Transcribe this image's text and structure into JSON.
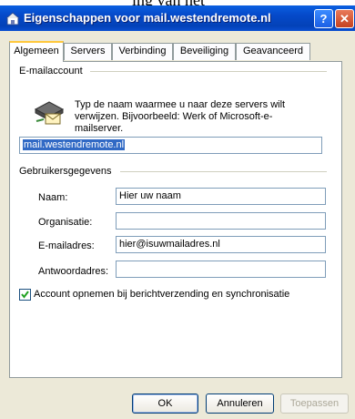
{
  "cropped_heading": "ing van het",
  "window": {
    "title": "Eigenschappen voor mail.westendremote.nl",
    "help_label": "?",
    "close_label": "✕"
  },
  "tabs": [
    {
      "label": "Algemeen",
      "active": true
    },
    {
      "label": "Servers",
      "active": false
    },
    {
      "label": "Verbinding",
      "active": false
    },
    {
      "label": "Beveiliging",
      "active": false
    },
    {
      "label": "Geavanceerd",
      "active": false
    }
  ],
  "mail_account": {
    "heading": "E-mailaccount",
    "description": "Typ de naam waarmee u naar deze servers wilt verwijzen. Bijvoorbeeld: Werk of Microsoft-e-mailserver.",
    "account_name": "mail.westendremote.nl"
  },
  "user_info": {
    "heading": "Gebruikersgegevens",
    "name_label": "Naam:",
    "name_value": "Hier uw naam",
    "org_label": "Organisatie:",
    "org_value": "",
    "email_label": "E-mailadres:",
    "email_value": "hier@isuwmailadres.nl",
    "reply_label": "Antwoordadres:",
    "reply_value": ""
  },
  "include_account": {
    "label": "Account opnemen bij berichtverzending en synchronisatie",
    "checked": true
  },
  "buttons": {
    "ok": "OK",
    "cancel": "Annuleren",
    "apply": "Toepassen"
  }
}
